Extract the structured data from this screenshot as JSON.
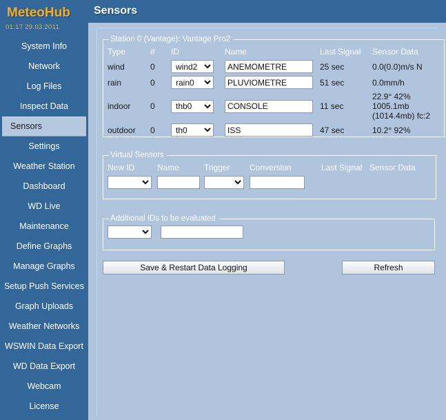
{
  "sidebar": {
    "brand": "MeteoHub",
    "clock": "01:17  29.03.2011",
    "items": [
      {
        "label": "System Info",
        "active": false
      },
      {
        "label": "Network",
        "active": false
      },
      {
        "label": "Log Files",
        "active": false
      },
      {
        "label": "Inspect Data",
        "active": false
      },
      {
        "label": "Sensors",
        "active": true
      },
      {
        "label": "Settings",
        "active": false
      },
      {
        "label": "Weather Station",
        "active": false
      },
      {
        "label": "Dashboard",
        "active": false
      },
      {
        "label": "WD Live",
        "active": false
      },
      {
        "label": "Maintenance",
        "active": false
      },
      {
        "label": "Define Graphs",
        "active": false
      },
      {
        "label": "Manage Graphs",
        "active": false
      },
      {
        "label": "Setup Push Services",
        "active": false
      },
      {
        "label": "Graph Uploads",
        "active": false
      },
      {
        "label": "Weather Networks",
        "active": false
      },
      {
        "label": "WSWIN Data Export",
        "active": false
      },
      {
        "label": "WD Data Export",
        "active": false
      },
      {
        "label": "Webcam",
        "active": false
      },
      {
        "label": "License",
        "active": false
      }
    ]
  },
  "header": {
    "title": "Sensors"
  },
  "station": {
    "legend": "Station 0 (Vantage): Vantage Pro2",
    "columns": {
      "type": "Type",
      "num": "#",
      "id": "ID",
      "name": "Name",
      "last_signal": "Last Signal",
      "sensor_data": "Sensor Data"
    },
    "rows": [
      {
        "type": "wind",
        "num": "0",
        "id": "wind2",
        "name": "ANEMOMETRE",
        "last_signal": "25 sec",
        "sensor_data": "0.0(0.0)m/s N"
      },
      {
        "type": "rain",
        "num": "0",
        "id": "rain0",
        "name": "PLUVIOMETRE",
        "last_signal": "51 sec",
        "sensor_data": "0.0mm/h"
      },
      {
        "type": "indoor",
        "num": "0",
        "id": "thb0",
        "name": "CONSOLE",
        "last_signal": "11 sec",
        "sensor_data": "22.9° 42% 1005.1mb (1014.4mb) fc:2"
      },
      {
        "type": "outdoor",
        "num": "0",
        "id": "th0",
        "name": "ISS",
        "last_signal": "47 sec",
        "sensor_data": "10.2° 92%"
      }
    ]
  },
  "virtual_sensors": {
    "legend": "Virtual Sensors",
    "columns": {
      "new_id": "New ID",
      "name": "Name",
      "trigger": "Trigger",
      "conversion": "Conversion",
      "last_signal": "Last Signal",
      "sensor_data": "Sensor Data"
    },
    "row": {
      "new_id": "",
      "name": "",
      "trigger": "",
      "conversion": "",
      "last_signal": "",
      "sensor_data": ""
    }
  },
  "additional_ids": {
    "legend": "Additional IDs to be evaluated",
    "select_value": "",
    "text_value": ""
  },
  "buttons": {
    "save": "Save & Restart Data Logging",
    "refresh": "Refresh"
  },
  "colors": {
    "brand_blue": "#336699",
    "brand_orange": "#f0ad33",
    "content_blue": "#b0c4de",
    "clock_olive": "#c8bb63"
  }
}
